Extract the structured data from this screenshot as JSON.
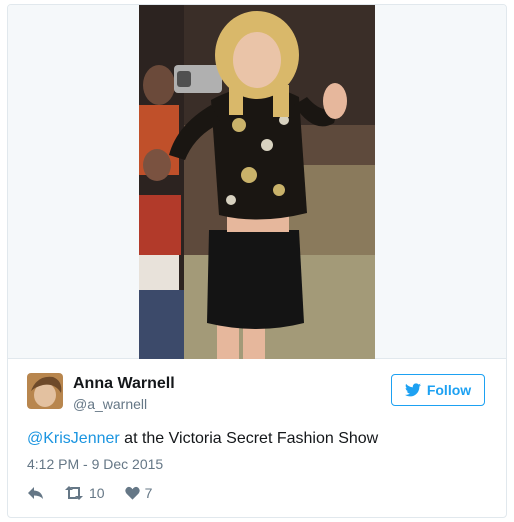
{
  "tweet": {
    "author_name": "Anna Warnell",
    "author_handle": "@a_warnell",
    "follow_label": "Follow",
    "mention": "@KrisJenner",
    "text_rest": " at the Victoria Secret Fashion Show",
    "timestamp": "4:12 PM - 9 Dec 2015",
    "retweet_count": "10",
    "like_count": "7"
  },
  "icons": {
    "bird": "twitter-bird-icon",
    "reply": "reply-icon",
    "retweet": "retweet-icon",
    "like": "heart-icon"
  },
  "colors": {
    "accent": "#1da1f2",
    "mention": "#1b95e0",
    "text": "#14171a",
    "muted": "#657786",
    "border": "#e1e8ed"
  }
}
